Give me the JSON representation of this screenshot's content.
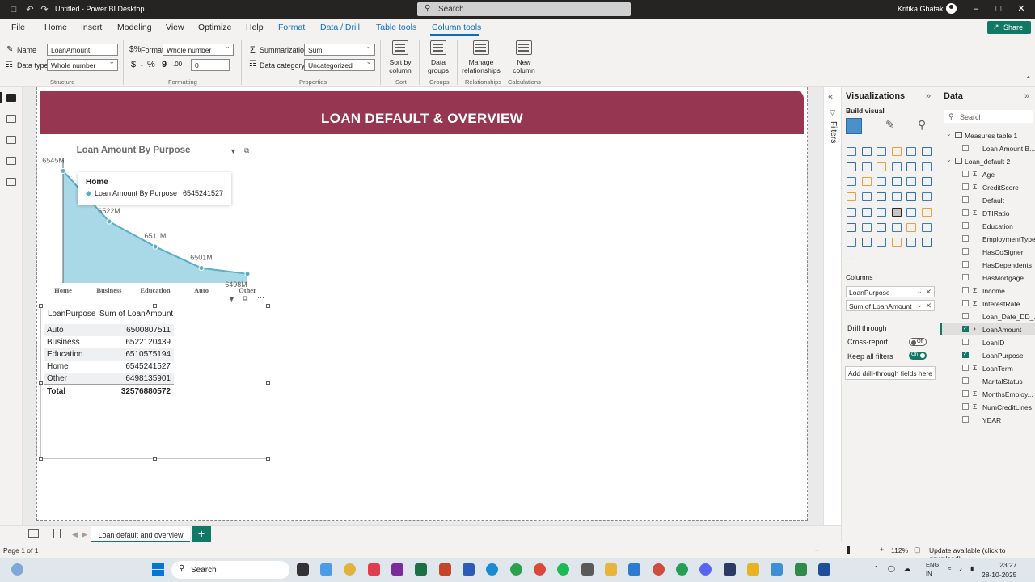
{
  "titlebar": {
    "doc_title": "Untitled - Power BI Desktop",
    "search_placeholder": "Search",
    "user_name": "Kritika Ghatak"
  },
  "menu": {
    "items": [
      "File",
      "Home",
      "Insert",
      "Modeling",
      "View",
      "Optimize",
      "Help",
      "Format",
      "Data / Drill",
      "Table tools",
      "Column tools"
    ],
    "share_label": "Share"
  },
  "ribbon": {
    "name_label": "Name",
    "name_value": "LoanAmount",
    "datatype_label": "Data type",
    "datatype_value": "Whole number",
    "format_label": "Format",
    "format_value": "Whole number",
    "decimals_value": "0",
    "summarization_label": "Summarization",
    "summarization_value": "Sum",
    "category_label": "Data category",
    "category_value": "Uncategorized",
    "sort_label": "Sort by column",
    "groups_label": "Data groups",
    "relationships_label": "Manage relationships",
    "newcol_label": "New column",
    "group_structure": "Structure",
    "group_formatting": "Formatting",
    "group_properties": "Properties",
    "group_sort": "Sort",
    "group_groups": "Groups",
    "group_relationships": "Relationships",
    "group_calculations": "Calculations"
  },
  "report": {
    "banner_title": "LOAN DEFAULT & OVERVIEW",
    "page_tab": "Loan default and overview"
  },
  "chart_data": {
    "type": "line",
    "title": "Loan Amount By Purpose",
    "categories": [
      "Home",
      "Business",
      "Education",
      "Auto",
      "Other"
    ],
    "series": [
      {
        "name": "Loan Amount By Purpose",
        "values": [
          6545241527,
          6522120439,
          6510575194,
          6500807511,
          6498135901
        ]
      }
    ],
    "data_labels": [
      "6545M",
      "6522M",
      "6511M",
      "6501M",
      "6498M"
    ],
    "ylim": [
      6494000000,
      6548000000
    ],
    "color": "#5aaec6",
    "fill": "#a9d8e6",
    "tooltip": {
      "category": "Home",
      "series": "Loan Amount By Purpose",
      "value": "6545241527"
    }
  },
  "table": {
    "headers": [
      "LoanPurpose",
      "Sum of LoanAmount"
    ],
    "rows": [
      {
        "purpose": "Auto",
        "amount": "6500807511"
      },
      {
        "purpose": "Business",
        "amount": "6522120439"
      },
      {
        "purpose": "Education",
        "amount": "6510575194"
      },
      {
        "purpose": "Home",
        "amount": "6545241527"
      },
      {
        "purpose": "Other",
        "amount": "6498135901"
      }
    ],
    "total_label": "Total",
    "total_value": "32576880572"
  },
  "filters": {
    "label": "Filters"
  },
  "viz": {
    "title": "Visualizations",
    "build_visual": "Build visual",
    "columns_label": "Columns",
    "wells": [
      "LoanPurpose",
      "Sum of LoanAmount"
    ],
    "drill_through": "Drill through",
    "cross_report": "Cross-report",
    "cross_report_state": "Off",
    "keep_filters": "Keep all filters",
    "keep_filters_state": "On",
    "add_drill": "Add drill-through fields here",
    "more": "..."
  },
  "data_pane": {
    "title": "Data",
    "search_placeholder": "Search",
    "tables": [
      {
        "name": "Measures table 1",
        "fields": [
          {
            "name": "Loan Amount B...",
            "sigma": false,
            "checked": false
          }
        ]
      },
      {
        "name": "Loan_default 2",
        "fields": [
          {
            "name": "Age",
            "sigma": true,
            "checked": false
          },
          {
            "name": "CreditScore",
            "sigma": true,
            "checked": false
          },
          {
            "name": "Default",
            "sigma": false,
            "checked": false
          },
          {
            "name": "DTIRatio",
            "sigma": true,
            "checked": false
          },
          {
            "name": "Education",
            "sigma": false,
            "checked": false
          },
          {
            "name": "EmploymentType",
            "sigma": false,
            "checked": false
          },
          {
            "name": "HasCoSigner",
            "sigma": false,
            "checked": false
          },
          {
            "name": "HasDependents",
            "sigma": false,
            "checked": false
          },
          {
            "name": "HasMortgage",
            "sigma": false,
            "checked": false
          },
          {
            "name": "Income",
            "sigma": true,
            "checked": false
          },
          {
            "name": "InterestRate",
            "sigma": true,
            "checked": false
          },
          {
            "name": "Loan_Date_DD_...",
            "sigma": false,
            "checked": false
          },
          {
            "name": "LoanAmount",
            "sigma": true,
            "checked": true
          },
          {
            "name": "LoanID",
            "sigma": false,
            "checked": false
          },
          {
            "name": "LoanPurpose",
            "sigma": false,
            "checked": true
          },
          {
            "name": "LoanTerm",
            "sigma": true,
            "checked": false
          },
          {
            "name": "MaritalStatus",
            "sigma": false,
            "checked": false
          },
          {
            "name": "MonthsEmploy...",
            "sigma": true,
            "checked": false
          },
          {
            "name": "NumCreditLines",
            "sigma": true,
            "checked": false
          },
          {
            "name": "YEAR",
            "sigma": false,
            "checked": false
          }
        ]
      }
    ]
  },
  "status": {
    "page": "Page 1 of 1",
    "zoom": "112%",
    "update": "Update available (click to download)"
  },
  "taskbar": {
    "search_placeholder": "Search",
    "lang_1": "ENG",
    "lang_2": "IN",
    "time": "23:27",
    "date": "28-10-2025"
  },
  "colors": {
    "banner": "#963650",
    "accent": "#117865",
    "line": "#5aaec6"
  }
}
